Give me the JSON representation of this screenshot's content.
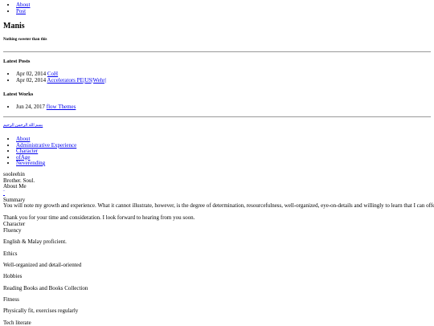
{
  "top_nav": {
    "items": [
      "About",
      "Post"
    ]
  },
  "site": {
    "title": "Manis",
    "tagline": "Nothing sweeter than this"
  },
  "latest_posts": {
    "heading": "Latest Posts",
    "items": [
      {
        "date": "Apr 02, 2014",
        "title": "CoH"
      },
      {
        "date": "Apr 02, 2014",
        "title": "Accelerators PE|US|Wehr|"
      }
    ]
  },
  "latest_works": {
    "heading": "Latest Works",
    "items": [
      {
        "date": "Jun 24, 2017",
        "title": "flow Themes"
      }
    ]
  },
  "bismillah": "بسم الله الرحمن الرحيم",
  "nav2": {
    "items": [
      "About",
      "Administrative Experience",
      "Character",
      "ofAge",
      "Neverending"
    ]
  },
  "profile": {
    "name": "sooleehin",
    "tagline": "Brother. Soul.",
    "section": "About Me"
  },
  "caret": "‾",
  "content": {
    "summary_label": "Summary",
    "summary_text": "You will note my growth and experience. What it cannot illustrate, however, is the degree of determination, resourcefulness, well-organized, eye-on-details and willingly to learn that I can offer.",
    "thanks": "Thank you for your time and consideration. I look forward to hearing from you soon.",
    "character_label": "Character",
    "fluency_label": "Fluency",
    "fluency_text": "English & Malay proficient.",
    "ethics_label": "Ethics",
    "ethics_text": "Well-organized and detail-oriented",
    "hobbies_label": "Hobbies",
    "hobbies_text": "Reading Books and Books Collection",
    "fitness_label": "Fitness",
    "fitness_text": "Physically fit, exercises regularly",
    "tech_label": "Tech literate"
  }
}
